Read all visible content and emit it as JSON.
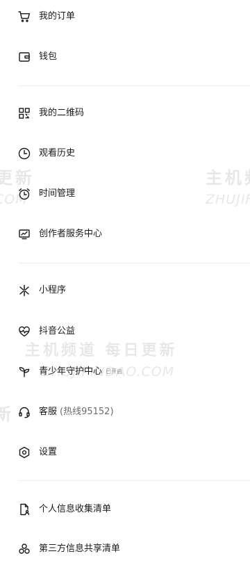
{
  "menu": {
    "orders": {
      "label": "我的订单",
      "icon": "cart-icon"
    },
    "wallet": {
      "label": "钱包",
      "icon": "wallet-icon"
    },
    "qrcode": {
      "label": "我的二维码",
      "icon": "qrcode-icon"
    },
    "history": {
      "label": "观看历史",
      "icon": "clock-icon"
    },
    "time": {
      "label": "时间管理",
      "icon": "alarm-clock-icon"
    },
    "creator": {
      "label": "创作者服务中心",
      "icon": "monitor-chart-icon"
    },
    "miniapp": {
      "label": "小程序",
      "icon": "asterisk-icon"
    },
    "charity": {
      "label": "抖音公益",
      "icon": "heart-pulse-icon"
    },
    "youth": {
      "label": "青少年守护中心",
      "badge": "已开启",
      "icon": "sprout-icon"
    },
    "service": {
      "label": "客服",
      "sub": "(热线95152)",
      "icon": "headset-icon"
    },
    "settings": {
      "label": "设置",
      "icon": "settings-hexagon-icon"
    },
    "personal_info": {
      "label": "个人信息收集清单",
      "icon": "document-user-icon"
    },
    "third_party": {
      "label": "第三方信息共享清单",
      "icon": "share-circles-icon"
    }
  },
  "watermarks": {
    "cn_right": "主机频",
    "en_right": "ZHUJIF",
    "cn_left_top": "更新",
    "en_left_top": "COM",
    "cn_center": "主机频道 每日更新",
    "en_center": "ZHUJIPINDAO.COM",
    "cn_left_mid": "新"
  },
  "colors": {
    "text": "#1a1a1a",
    "divider": "#ececec",
    "secondary": "#6b6b6b"
  }
}
